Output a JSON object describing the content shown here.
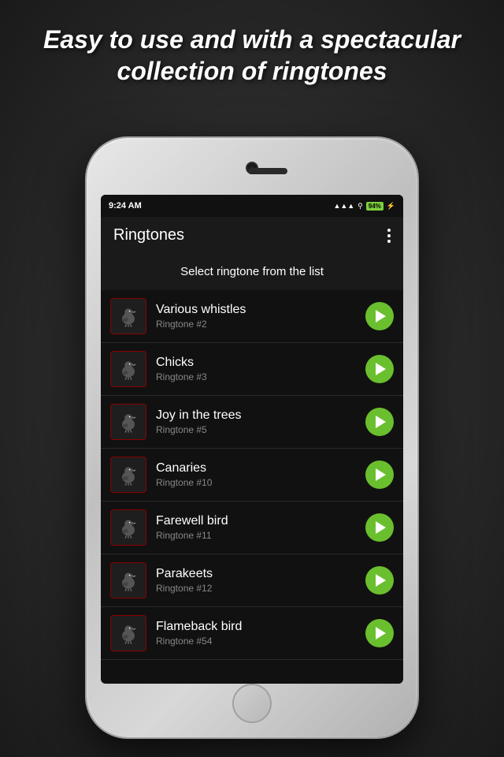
{
  "headline": {
    "text": "Easy to use and with a spectacular collection of ringtones"
  },
  "statusBar": {
    "time": "9:24 AM",
    "battery": "94%",
    "signal": "▲▲▲",
    "wifi": "WiFi"
  },
  "appHeader": {
    "title": "Ringtones",
    "moreLabel": "⋮"
  },
  "subtitle": {
    "text": "Select ringtone from the list"
  },
  "ringtones": [
    {
      "name": "Various whistles",
      "subtitle": "Ringtone #2"
    },
    {
      "name": "Chicks",
      "subtitle": "Ringtone #3"
    },
    {
      "name": "Joy in the trees",
      "subtitle": "Ringtone #5"
    },
    {
      "name": "Canaries",
      "subtitle": "Ringtone #10"
    },
    {
      "name": "Farewell bird",
      "subtitle": "Ringtone #11"
    },
    {
      "name": "Parakeets",
      "subtitle": "Ringtone #12"
    },
    {
      "name": "Flameback bird",
      "subtitle": "Ringtone #54"
    }
  ]
}
